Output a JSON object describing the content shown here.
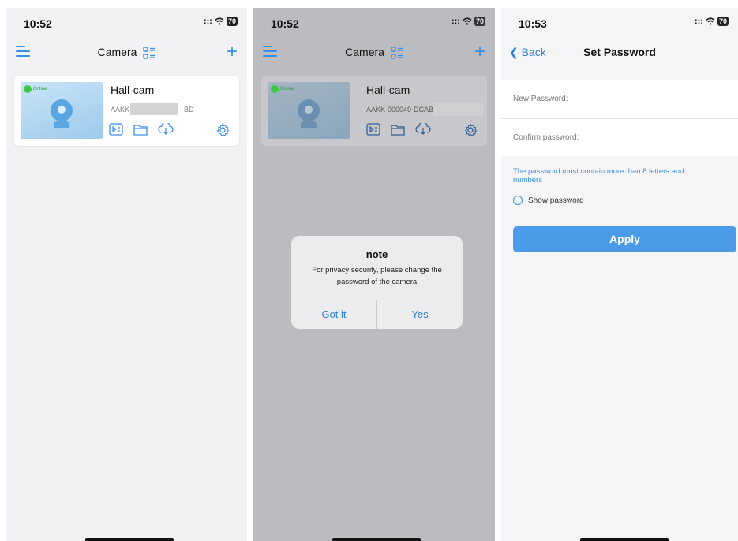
{
  "panel1": {
    "time": "10:52",
    "battery": "70",
    "nav_title": "Camera",
    "device": {
      "name": "Hall-cam",
      "status": "Online",
      "id_start": "AAKK",
      "id_end": "BD"
    }
  },
  "panel2": {
    "time": "10:52",
    "battery": "70",
    "nav_title": "Camera",
    "device": {
      "name": "Hall-cam",
      "status": "Online",
      "id": "AAKK-000049-DCABI"
    },
    "alert": {
      "title": "note",
      "message": "For privacy security, please change the password of the camera",
      "button_left": "Got it",
      "button_right": "Yes"
    }
  },
  "panel3": {
    "time": "10:53",
    "battery": "70",
    "back_label": "Back",
    "title": "Set Password",
    "new_password_placeholder": "New Password:",
    "confirm_password_placeholder": "Confirm password:",
    "hint": "The password must contain more than 8 letters and numbers",
    "show_password_label": "Show password",
    "apply_label": "Apply"
  },
  "colors": {
    "accent": "#3a8ee6",
    "link": "#2f7fd8",
    "online": "#3ec84b",
    "apply_bg": "#4a9be8"
  }
}
